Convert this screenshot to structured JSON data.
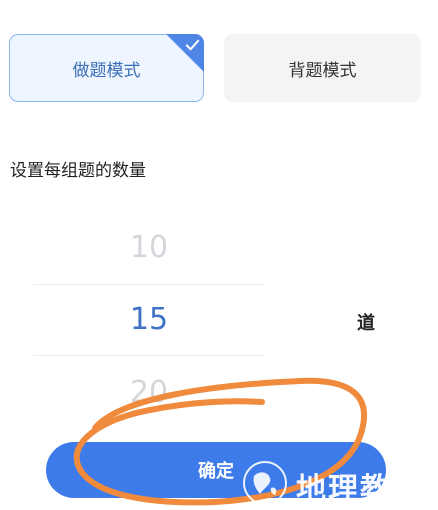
{
  "labels": {
    "title": "",
    "mode_section": {
      "title": "",
      "options": [
        {
          "label": "做题模式",
          "selected": true
        },
        {
          "label": "背题模式",
          "selected": false
        }
      ]
    },
    "quantity_section": {
      "title": "设置每组题的数量",
      "picker_values": [
        "10",
        "15",
        "20"
      ],
      "selected_value": "15",
      "unit": "道"
    },
    "confirm_button": "确定"
  },
  "colors": {
    "accent": "#3d7bea",
    "selected_text": "#3b6fb5",
    "selected_bg": "#eef5ff",
    "annotation": "#f08a3c"
  },
  "watermark": {
    "text": "地理教",
    "icon": "globe-logo-icon"
  }
}
